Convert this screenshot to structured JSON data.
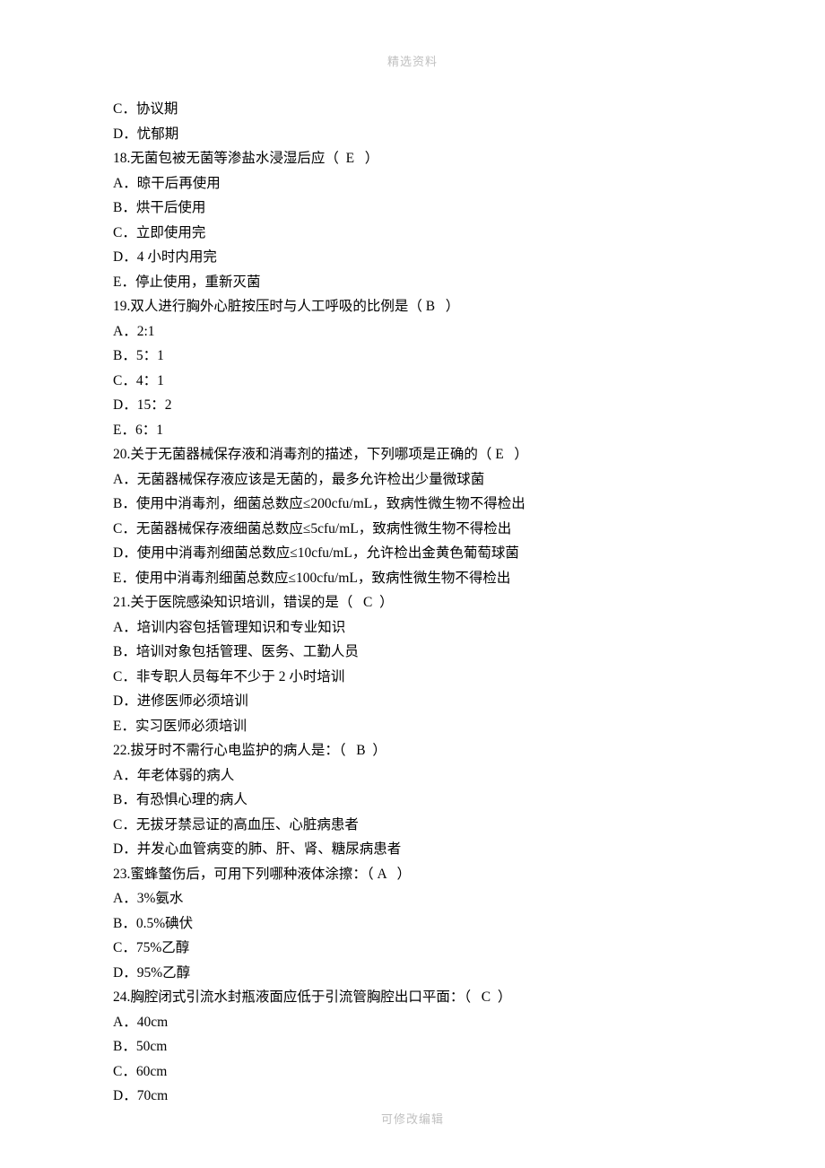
{
  "header": "精选资料",
  "footer": "可修改编辑",
  "lines": [
    "C．协议期",
    "D．忧郁期",
    "18.无菌包被无菌等渗盐水浸湿后应（  E   ）",
    "A．晾干后再使用",
    "B．烘干后使用",
    "C．立即使用完",
    "D．4 小时内用完",
    "E．停止使用，重新灭菌",
    "19.双人进行胸外心脏按压时与人工呼吸的比例是（ B   ）",
    "A．2:1",
    "B．5：1",
    "C．4：1",
    "D．15：2",
    "E．6：1",
    "20.关于无菌器械保存液和消毒剂的描述，下列哪项是正确的（ E   ）",
    "A．无菌器械保存液应该是无菌的，最多允许检出少量微球菌",
    "B．使用中消毒剂，细菌总数应≤200cfu/mL，致病性微生物不得检出",
    "C．无菌器械保存液细菌总数应≤5cfu/mL，致病性微生物不得检出",
    "D．使用中消毒剂细菌总数应≤10cfu/mL，允许检出金黄色葡萄球菌",
    "E．使用中消毒剂细菌总数应≤100cfu/mL，致病性微生物不得检出",
    "21.关于医院感染知识培训，错误的是（   C  ）",
    "A．培训内容包括管理知识和专业知识",
    "B．培训对象包括管理、医务、工勤人员",
    "C．非专职人员每年不少于 2 小时培训",
    "D．进修医师必须培训",
    "E．实习医师必须培训",
    "22.拔牙时不需行心电监护的病人是：（   B  ）",
    "A．年老体弱的病人",
    "B．有恐惧心理的病人",
    "C．无拔牙禁忌证的高血压、心脏病患者",
    "D．并发心血管病变的肺、肝、肾、糖尿病患者",
    "23.蜜蜂螫伤后，可用下列哪种液体涂擦：（ A   ）",
    "A．3%氨水",
    "B．0.5%碘伏",
    "C．75%乙醇",
    "D．95%乙醇",
    "24.胸腔闭式引流水封瓶液面应低于引流管胸腔出口平面：（   C  ）",
    "A．40cm",
    "B．50cm",
    "C．60cm",
    "D．70cm"
  ]
}
